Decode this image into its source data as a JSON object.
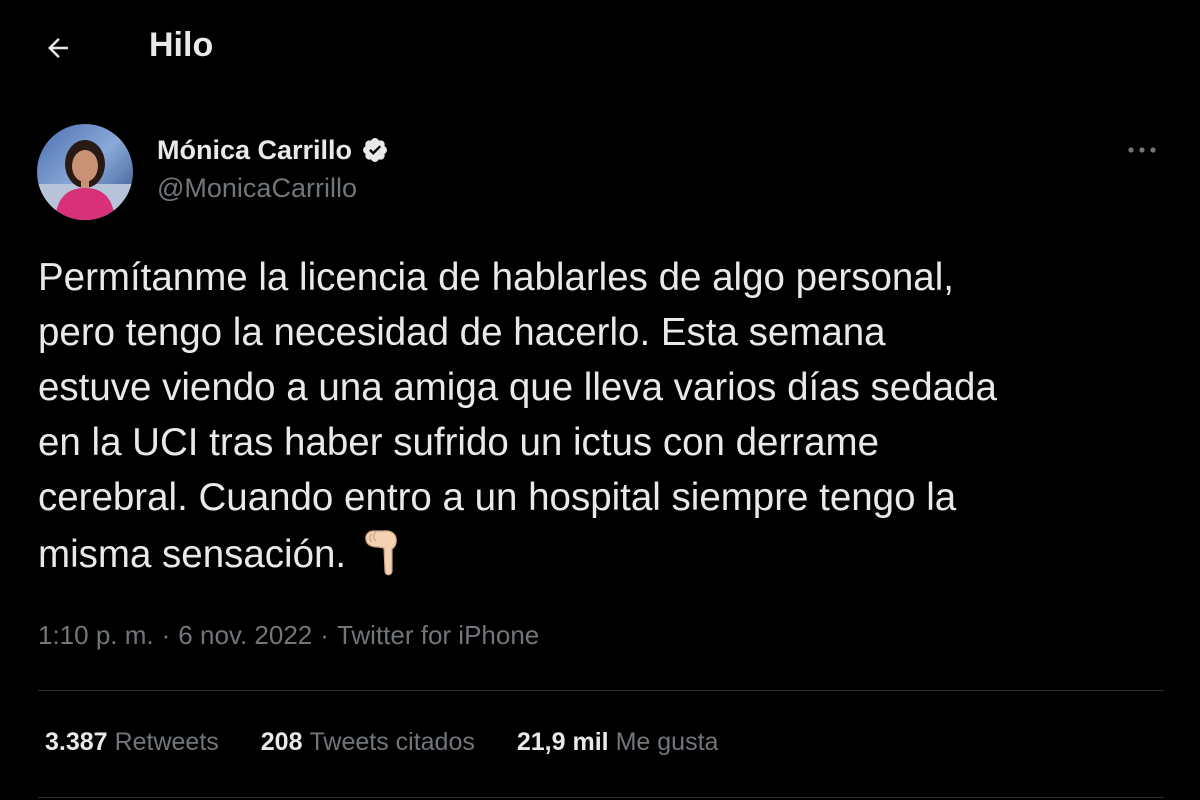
{
  "header": {
    "title": "Hilo",
    "back_icon": "arrow-left-icon"
  },
  "author": {
    "name": "Mónica Carrillo",
    "handle": "@MonicaCarrillo",
    "verified": true,
    "verified_icon": "verified-badge-icon"
  },
  "tweet": {
    "text": "Permítanme la licencia de hablarles de algo personal,\npero tengo la necesidad de hacerlo. Esta semana\nestuve viendo a una amiga que lleva varios días sedada\nen la UCI tras haber sufrido un ictus con derrame\ncerebral. Cuando entro a un hospital siempre tengo la\nmisma sensación.",
    "emoji_icon": "pointing-down-hand-icon",
    "time": "1:10 p. m.",
    "separator": "·",
    "date": "6 nov. 2022",
    "source": "Twitter for iPhone"
  },
  "stats": {
    "retweets_count": "3.387",
    "retweets_label": "Retweets",
    "quotes_count": "208",
    "quotes_label": "Tweets citados",
    "likes_count": "21,9 mil",
    "likes_label": "Me gusta"
  },
  "colors": {
    "background": "#000000",
    "text_primary": "#e7e9ea",
    "text_secondary": "#71767b",
    "divider": "#2f3336",
    "verified_badge": "#e7e9ea"
  }
}
